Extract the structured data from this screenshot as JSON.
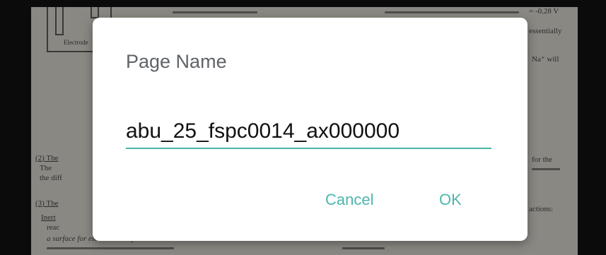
{
  "background_document": {
    "snippets": [
      "Electrode",
      "= -0.28 V",
      "essentially",
      "Na⁺ will",
      "(2) The",
      "The",
      "the diff",
      "for the",
      "(3) The",
      "actions:",
      "Inert",
      "reac",
      "a surface for electron transfer."
    ]
  },
  "dialog": {
    "title": "Page Name",
    "page_name_value": "abu_25_fspc0014_ax000000",
    "cancel_label": "Cancel",
    "ok_label": "OK"
  },
  "colors": {
    "accent": "#4db6ac",
    "underline": "#49b7a8",
    "title": "#5f6368"
  }
}
